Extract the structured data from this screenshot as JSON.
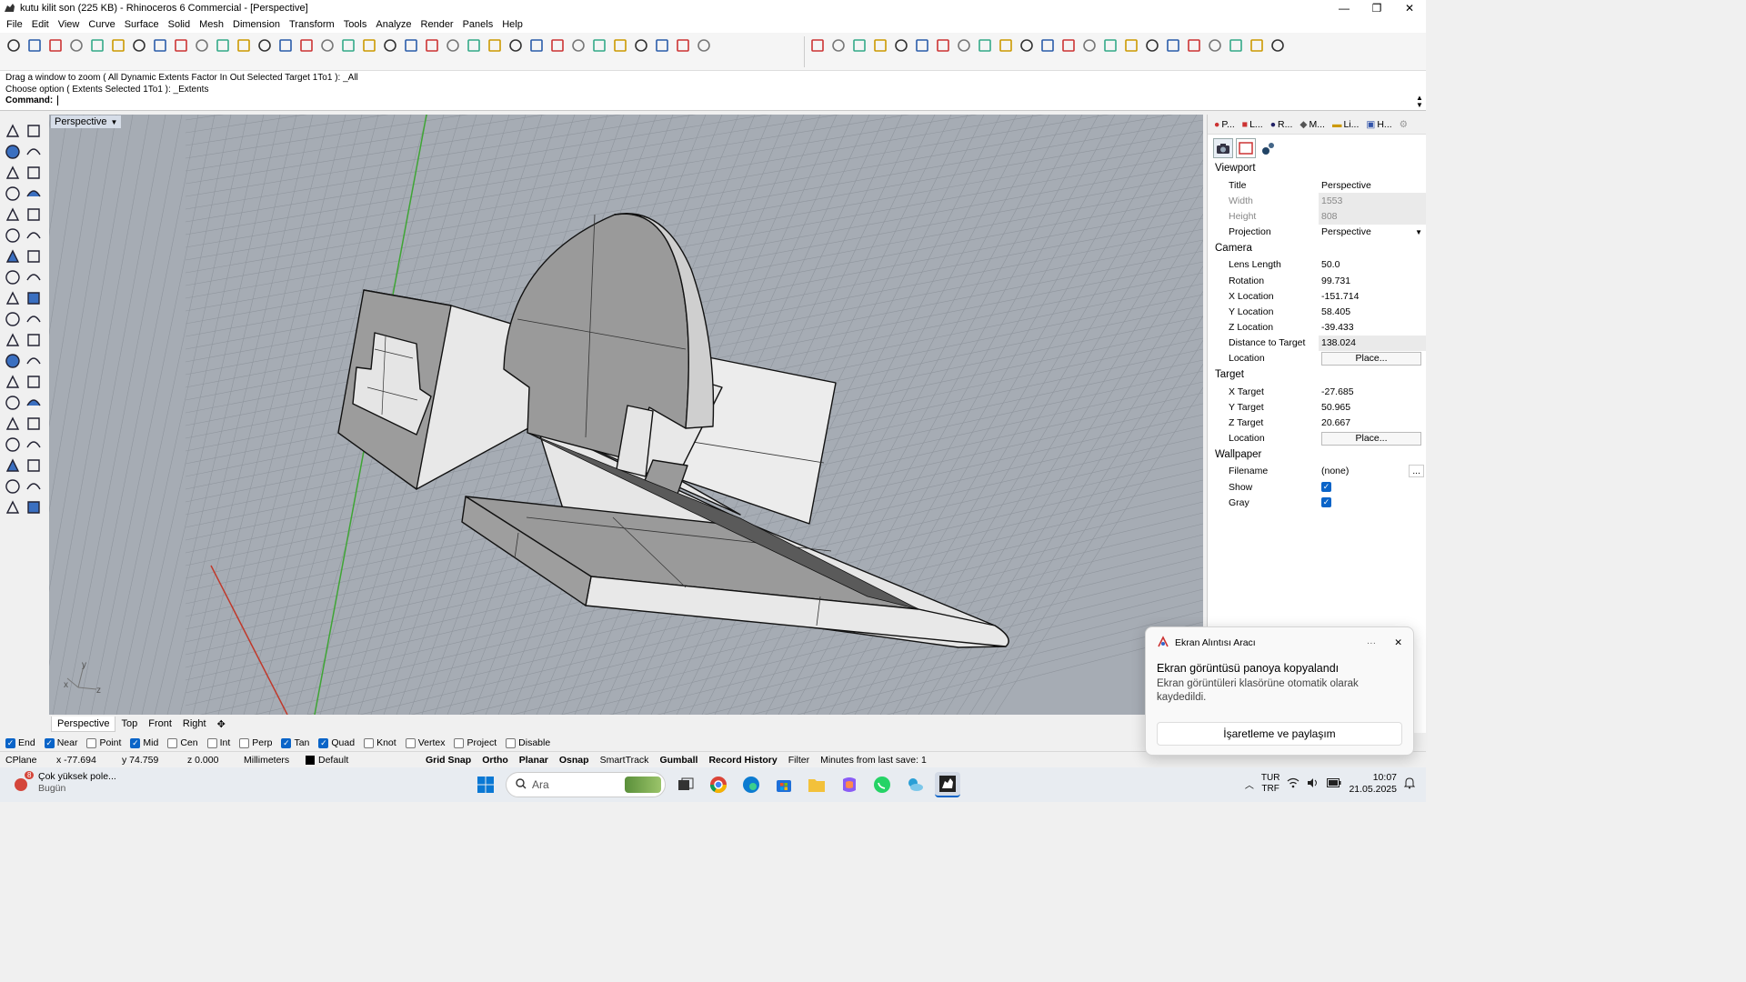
{
  "window": {
    "title": "kutu kilit son (225 KB) - Rhinoceros 6 Commercial - [Perspective]",
    "minimize": "—",
    "maximize": "❐",
    "close": "✕"
  },
  "menu": [
    "File",
    "Edit",
    "View",
    "Curve",
    "Surface",
    "Solid",
    "Mesh",
    "Dimension",
    "Transform",
    "Tools",
    "Analyze",
    "Render",
    "Panels",
    "Help"
  ],
  "command": {
    "history_1": "Drag a window to zoom ( All  Dynamic  Extents  Factor  In  Out  Selected  Target  1To1 ): _All",
    "history_2": "Choose option ( Extents  Selected  1To1 ): _Extents",
    "prompt": "Command:",
    "value": ""
  },
  "viewport": {
    "title": "Perspective",
    "axis_y": "y",
    "axis_z": "z",
    "axis_x": "x"
  },
  "viewport_tabs": [
    "Perspective",
    "Top",
    "Front",
    "Right"
  ],
  "panel": {
    "tabs": [
      "P...",
      "L...",
      "R...",
      "M...",
      "Li...",
      "H..."
    ],
    "viewport_header": "Viewport",
    "camera_header": "Camera",
    "target_header": "Target",
    "wallpaper_header": "Wallpaper",
    "viewport_rows": [
      {
        "key": "Title",
        "value": "Perspective"
      },
      {
        "key": "Width",
        "value": "1553"
      },
      {
        "key": "Height",
        "value": "808"
      },
      {
        "key": "Projection",
        "value": "Perspective"
      }
    ],
    "camera_rows": [
      {
        "key": "Lens Length",
        "value": "50.0"
      },
      {
        "key": "Rotation",
        "value": "99.731"
      },
      {
        "key": "X Location",
        "value": "-151.714"
      },
      {
        "key": "Y Location",
        "value": "58.405"
      },
      {
        "key": "Z Location",
        "value": "-39.433"
      },
      {
        "key": "Distance to Target",
        "value": "138.024"
      },
      {
        "key": "Location",
        "value": "Place..."
      }
    ],
    "target_rows": [
      {
        "key": "X Target",
        "value": "-27.685"
      },
      {
        "key": "Y Target",
        "value": "50.965"
      },
      {
        "key": "Z Target",
        "value": "20.667"
      },
      {
        "key": "Location",
        "value": "Place..."
      }
    ],
    "wallpaper_rows": [
      {
        "key": "Filename",
        "value": "(none)",
        "extra": "..."
      },
      {
        "key": "Show",
        "checked": true
      },
      {
        "key": "Gray",
        "checked": true
      }
    ]
  },
  "osnap": [
    {
      "label": "End",
      "checked": true
    },
    {
      "label": "Near",
      "checked": true
    },
    {
      "label": "Point",
      "checked": false
    },
    {
      "label": "Mid",
      "checked": true
    },
    {
      "label": "Cen",
      "checked": false
    },
    {
      "label": "Int",
      "checked": false
    },
    {
      "label": "Perp",
      "checked": false
    },
    {
      "label": "Tan",
      "checked": true
    },
    {
      "label": "Quad",
      "checked": true
    },
    {
      "label": "Knot",
      "checked": false
    },
    {
      "label": "Vertex",
      "checked": false
    },
    {
      "label": "Project",
      "checked": false
    },
    {
      "label": "Disable",
      "checked": false
    }
  ],
  "status": {
    "cplane": "CPlane",
    "x": "x -77.694",
    "y": "y 74.759",
    "z": "z 0.000",
    "units": "Millimeters",
    "layer": "Default",
    "grid_snap": "Grid Snap",
    "ortho": "Ortho",
    "planar": "Planar",
    "osnap": "Osnap",
    "smarttrack": "SmartTrack",
    "gumball": "Gumball",
    "record_history": "Record History",
    "filter": "Filter",
    "last_save": "Minutes from last save: 1"
  },
  "toast": {
    "app": "Ekran Alıntısı Aracı",
    "more": "···",
    "close": "✕",
    "title": "Ekran görüntüsü panoya kopyalandı",
    "body": "Ekran görüntüleri klasörüne otomatik olarak kaydedildi.",
    "button": "İşaretleme ve paylaşım"
  },
  "taskbar": {
    "weather_badge": "8",
    "weather_title": "Çok yüksek pole...",
    "weather_sub": "Bugün",
    "search_placeholder": "Ara",
    "lang_1": "TUR",
    "lang_2": "TRF",
    "time": "10:07",
    "date": "21.05.2025"
  },
  "colors": {
    "viewport_bg": "#a6acb4",
    "accent": "#0a64c8",
    "x_axis": "#c0392b",
    "y_axis": "#3fa535"
  }
}
